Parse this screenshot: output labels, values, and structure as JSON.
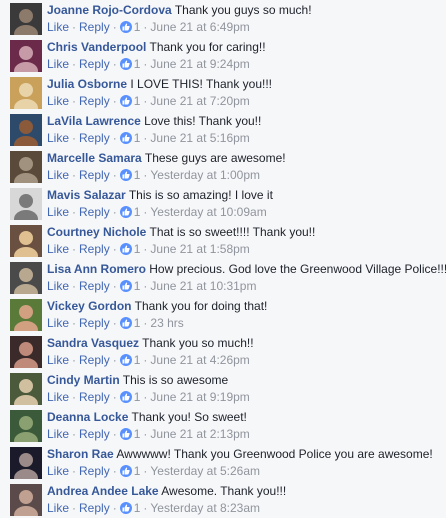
{
  "ui": {
    "like": "Like",
    "reply": "Reply",
    "dot": "·"
  },
  "colors": {
    "link": "#4267b2",
    "author": "#365899",
    "meta": "#90949c",
    "like_badge": "#5890ff"
  },
  "comments": [
    {
      "author": "Joanne Rojo-Cordova",
      "text": "Thank you guys so much!",
      "likes": "1",
      "time": "June 21 at 6:49pm",
      "avatar": [
        "#3a3a3a",
        "#8c7a6b"
      ]
    },
    {
      "author": "Chris Vanderpool",
      "text": "Thank you for caring!!",
      "likes": "1",
      "time": "June 21 at 9:24pm",
      "avatar": [
        "#6b2a4a",
        "#c79aa8"
      ]
    },
    {
      "author": "Julia Osborne",
      "text": "I LOVE THIS! Thank you!!!",
      "likes": "1",
      "time": "June 21 at 7:20pm",
      "avatar": [
        "#c9a15a",
        "#e8d2a8"
      ]
    },
    {
      "author": "LaVila Lawrence",
      "text": "Love this! Thank you!!",
      "likes": "1",
      "time": "June 21 at 5:16pm",
      "avatar": [
        "#2e4a6b",
        "#8a5a3a"
      ]
    },
    {
      "author": "Marcelle Samara",
      "text": "These guys are awesome!",
      "likes": "1",
      "time": "Yesterday at 1:00pm",
      "avatar": [
        "#5a4a3a",
        "#a0927e"
      ]
    },
    {
      "author": "Mavis Salazar",
      "text": "This is so amazing! I love it",
      "likes": "1",
      "time": "Yesterday at 10:09am",
      "avatar": [
        "#d8d8d8",
        "#7a7a7a"
      ]
    },
    {
      "author": "Courtney Nichole",
      "text": "That is so sweet!!!! Thank you!!",
      "likes": "1",
      "time": "June 21 at 1:58pm",
      "avatar": [
        "#6a5040",
        "#e0c090"
      ]
    },
    {
      "author": "Lisa Ann Romero",
      "text": "How precious. God love the Greenwood Village Police!!!",
      "likes": "1",
      "time": "June 21 at 10:31pm",
      "avatar": [
        "#4a4a4a",
        "#b8a890"
      ]
    },
    {
      "author": "Vickey Gordon",
      "text": "Thank you for doing that!",
      "likes": "1",
      "time": "23 hrs",
      "avatar": [
        "#5a7a3a",
        "#d0a080"
      ]
    },
    {
      "author": "Sandra Vasquez",
      "text": "Thank you so much!!",
      "likes": "1",
      "time": "June 21 at 4:26pm",
      "avatar": [
        "#3a2a2a",
        "#c08a7a"
      ]
    },
    {
      "author": "Cindy Martin",
      "text": "This is so awesome",
      "likes": "1",
      "time": "June 21 at 9:19pm",
      "avatar": [
        "#4a5a3a",
        "#d0c0a0"
      ]
    },
    {
      "author": "Deanna Locke",
      "text": "Thank you! So sweet!",
      "likes": "1",
      "time": "June 21 at 2:13pm",
      "avatar": [
        "#3a5a3a",
        "#8aa070"
      ]
    },
    {
      "author": "Sharon Rae",
      "text": "Awwwww! Thank you Greenwood Police you are awesome!",
      "likes": "1",
      "time": "Yesterday at 5:26am",
      "avatar": [
        "#1a1a2a",
        "#9a8a8a"
      ]
    },
    {
      "author": "Andrea Andee Lake",
      "text": "Awesome. Thank you!!!",
      "likes": "1",
      "time": "Yesterday at 8:23am",
      "avatar": [
        "#5a4a4a",
        "#c0a090"
      ]
    }
  ]
}
